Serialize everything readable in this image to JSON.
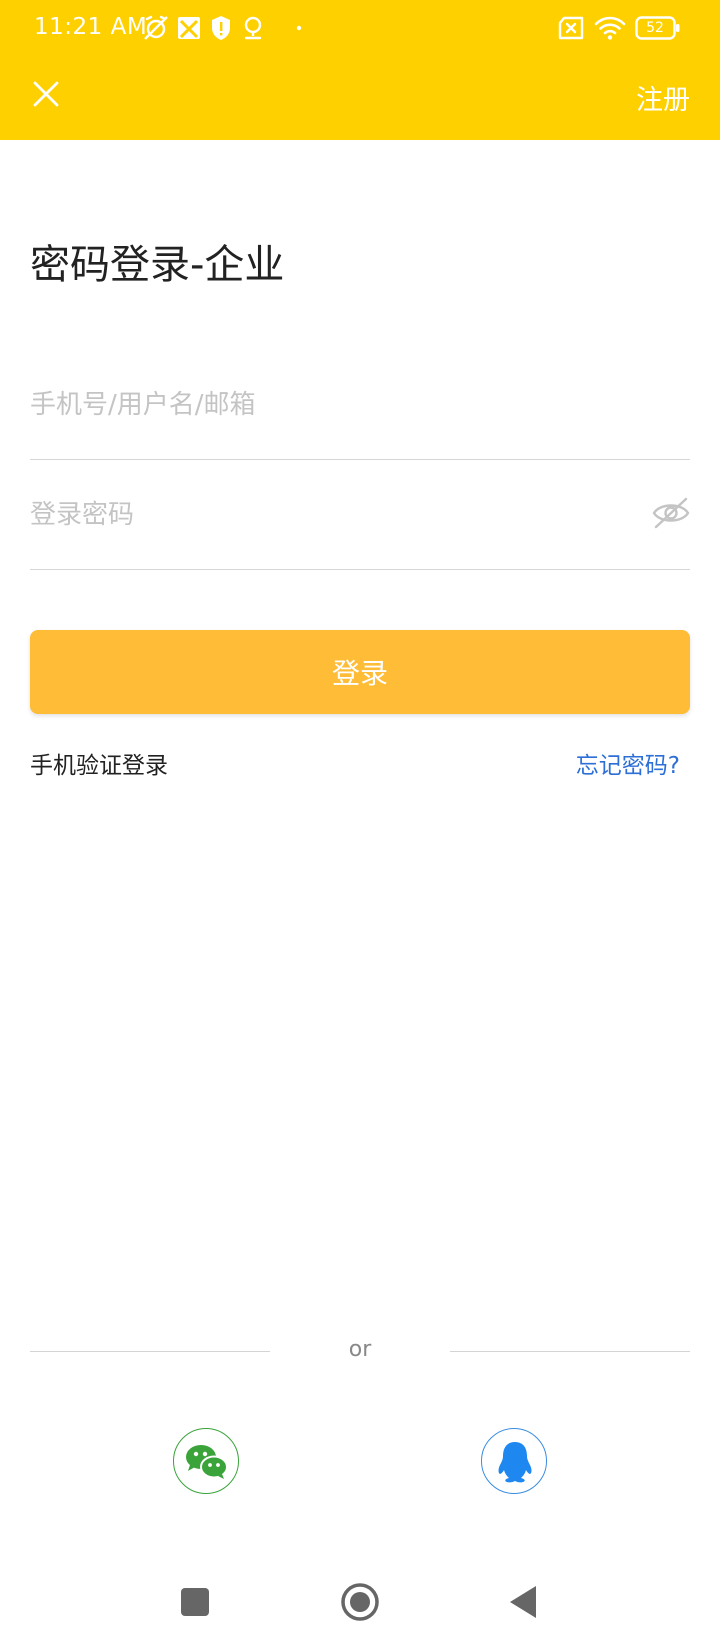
{
  "status_bar": {
    "time": "11:21 AM",
    "battery_level": "52"
  },
  "app_bar": {
    "register_label": "注册"
  },
  "page_title": "密码登录-企业",
  "form": {
    "username_placeholder": "手机号/用户名/邮箱",
    "username_value": "",
    "password_placeholder": "登录密码",
    "password_value": "",
    "login_button_label": "登录"
  },
  "links": {
    "sms_login": "手机验证登录",
    "forgot_password": "忘记密码?"
  },
  "divider_text": "or",
  "icons": {
    "close": "close-icon",
    "eye": "eye-off-icon",
    "wechat": "wechat-icon",
    "qq": "qq-icon"
  },
  "colors": {
    "header_bg": "#FFD000",
    "login_button_bg": "#FFBC36",
    "link_blue": "#2d6fd6",
    "wechat_green": "#3aa33a",
    "qq_blue": "#1e88f0"
  }
}
